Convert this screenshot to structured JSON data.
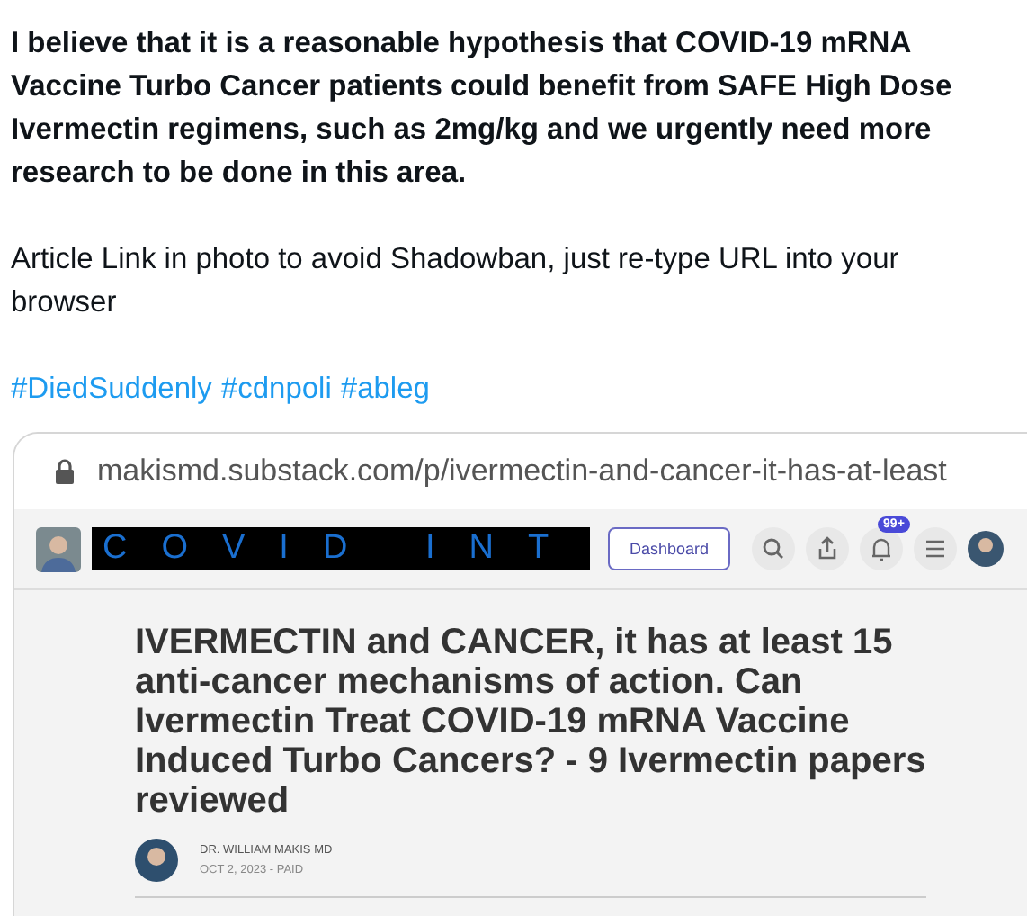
{
  "post": {
    "paragraphs": [
      "I believe that it is a reasonable hypothesis that COVID-19 mRNA Vaccine Turbo Cancer patients could benefit from SAFE High Dose Ivermectin regimens, such as 2mg/kg and we urgently need more research to be done in this area."
    ],
    "note": "Article Link in photo to avoid Shadowban, just re-type URL into your browser",
    "hashtags": [
      "#DiedSuddenly",
      "#cdnpoli",
      "#ableg"
    ]
  },
  "screenshot": {
    "url": "makismd.substack.com/p/ivermectin-and-cancer-it-has-at-least",
    "logo_text": "COVID INT",
    "dashboard_button": "Dashboard",
    "notification_badge": "99+",
    "headline": "IVERMECTIN and CANCER, it has at least 15 anti-cancer mechanisms of action. Can Ivermectin Treat COVID-19 mRNA Vaccine Induced Turbo Cancers? - 9 Ivermectin papers reviewed",
    "author": "DR. WILLIAM MAKIS MD",
    "date": "OCT 2, 2023 - PAID"
  }
}
